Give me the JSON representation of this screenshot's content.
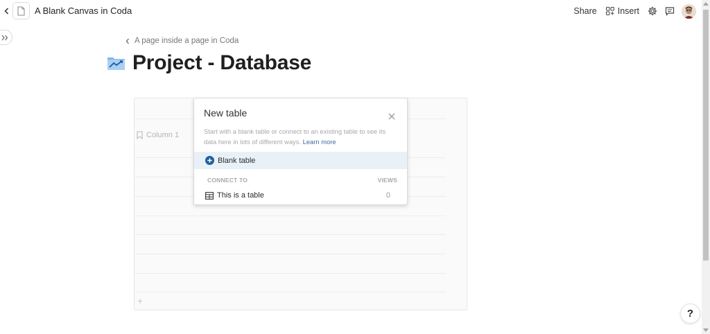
{
  "topbar": {
    "doc_title": "A Blank Canvas in Coda",
    "share_label": "Share",
    "insert_label": "Insert",
    "icons": [
      "chevron-left-icon",
      "document-icon",
      "insert-grid-icon",
      "gear-icon",
      "comment-icon",
      "avatar"
    ]
  },
  "breadcrumb": {
    "label": "A page inside a page in Coda"
  },
  "page": {
    "title": "Project - Database",
    "emoji": "chart-increasing-icon"
  },
  "table": {
    "column_header": "Column 1",
    "add_row_label": "+"
  },
  "new_table_popup": {
    "title": "New table",
    "description": "Start with a blank table or connect to an existing table to see its data here in lots of different ways.",
    "learn_more": "Learn more",
    "blank_table_label": "Blank table",
    "connect_to_header": "CONNECT TO",
    "views_header": "VIEWS",
    "connect_items": [
      {
        "label": "This is a table",
        "views": "0"
      }
    ]
  },
  "help": {
    "label": "?"
  },
  "colors": {
    "accent_blue": "#1f5f9e",
    "highlight_row": "#e9f1f8",
    "link": "#3d6ea0"
  }
}
